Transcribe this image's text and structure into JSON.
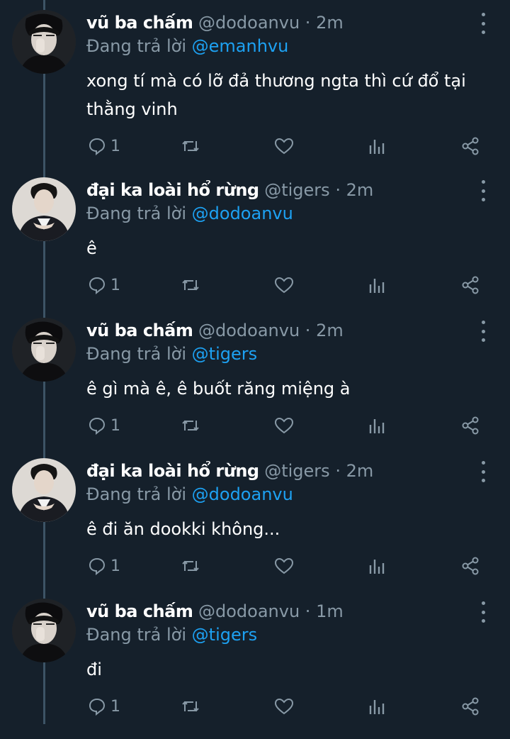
{
  "tweets": [
    {
      "author": "vũ ba chấm",
      "handle": "@dodoanvu",
      "time": "2m",
      "reply_prefix": "Đang trả lời",
      "reply_to": "@emanhvu",
      "text_lines": [
        "xong tí mà có lỡ đả thương ngta thì cứ đổ tại",
        "thằng vinh"
      ],
      "reply_count": "1",
      "avatar_icon": "avatar-photo"
    },
    {
      "author": "đại ka loài hổ rừng",
      "handle": "@tigers",
      "time": "2m",
      "reply_prefix": "Đang trả lời",
      "reply_to": "@dodoanvu",
      "text_lines": [
        "ê"
      ],
      "reply_count": "1",
      "avatar_icon": "avatar-photo"
    },
    {
      "author": "vũ ba chấm",
      "handle": "@dodoanvu",
      "time": "2m",
      "reply_prefix": "Đang trả lời",
      "reply_to": "@tigers",
      "text_lines": [
        "ê gì mà ê, ê buốt răng miệng à"
      ],
      "reply_count": "1",
      "avatar_icon": "avatar-photo"
    },
    {
      "author": "đại ka loài hổ rừng",
      "handle": "@tigers",
      "time": "2m",
      "reply_prefix": "Đang trả lời",
      "reply_to": "@dodoanvu",
      "text_lines": [
        "ê đi ăn dookki không..."
      ],
      "reply_count": "1",
      "avatar_icon": "avatar-photo"
    },
    {
      "author": "vũ ba chấm",
      "handle": "@dodoanvu",
      "time": "1m",
      "reply_prefix": "Đang trả lời",
      "reply_to": "@tigers",
      "text_lines": [
        "đi"
      ],
      "reply_count": "1",
      "avatar_icon": "avatar-photo"
    }
  ],
  "separator": "·",
  "action_icons": [
    "reply-icon",
    "retweet-icon",
    "like-icon",
    "analytics-icon",
    "share-icon"
  ],
  "colors": {
    "background": "#15202b",
    "muted": "#8899a6",
    "link": "#1da1f2",
    "text": "#ffffff",
    "thread_line": "#3d5466"
  }
}
